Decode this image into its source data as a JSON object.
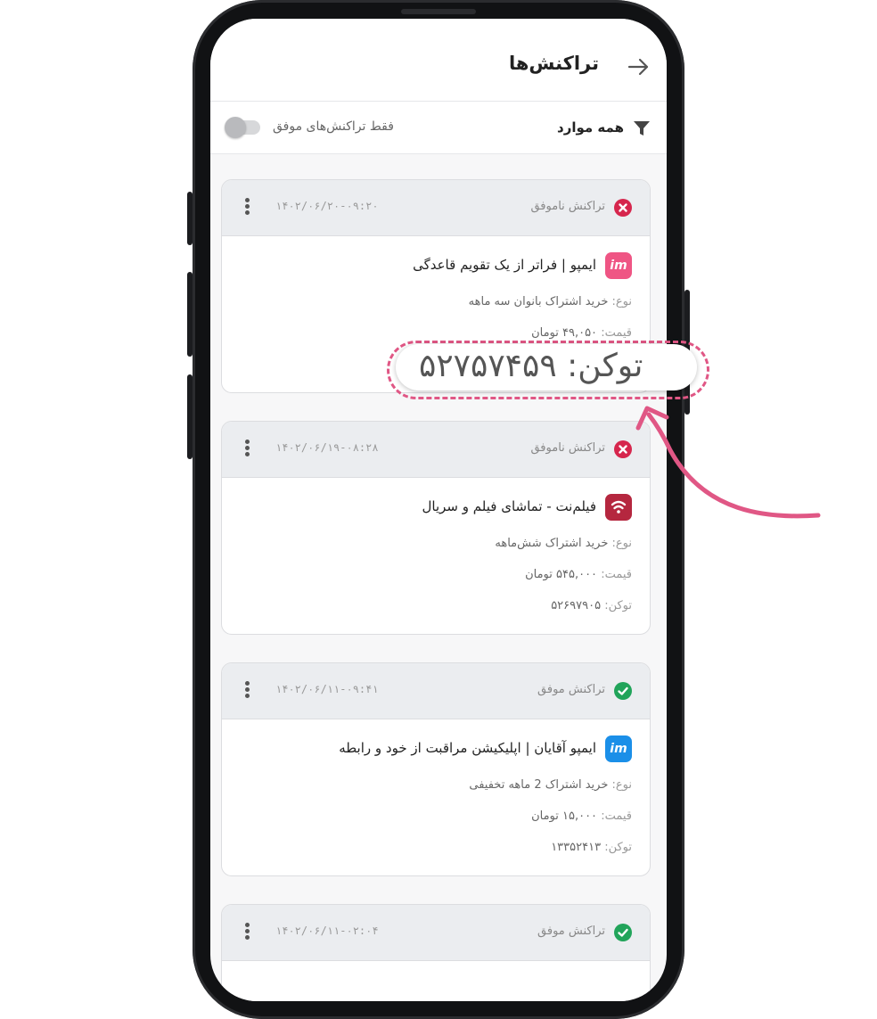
{
  "header": {
    "title": "تراکنش‌ها",
    "back_icon": "arrow-right-icon"
  },
  "filter": {
    "label": "همه موارد",
    "icon": "filter-icon",
    "toggle_label": "فقط تراکنش‌های موفق",
    "toggle_on": false
  },
  "labels": {
    "type_key": "نوع:",
    "price_key": "قیمت:",
    "token_key": "توکن:"
  },
  "transactions": [
    {
      "status": "تراکنش ناموفق",
      "status_type": "failed",
      "date": "۱۴۰۲/۰۶/۲۰-۰۹:۲۰",
      "app_logo_text": "im",
      "app_logo_color": "#ef5584",
      "app_name": "ایمپو | فراتر از یک تقویم قاعدگی",
      "type": "خرید اشتراک بانوان سه ماهه",
      "price": "۴۹,۰۵۰ تومان",
      "token": ""
    },
    {
      "status": "تراکنش ناموفق",
      "status_type": "failed",
      "date": "۱۴۰۲/۰۶/۱۹-۰۸:۲۸",
      "app_logo_text": "f",
      "app_logo_color": "#b5273f",
      "app_name": "فیلم‌نت - تماشای فیلم و سریال",
      "type": "خرید اشتراک شش‌ماهه",
      "price": "۵۴۵,۰۰۰ تومان",
      "token": "۵۲۶۹۷۹۰۵"
    },
    {
      "status": "تراکنش موفق",
      "status_type": "success",
      "date": "۱۴۰۲/۰۶/۱۱-۰۹:۴۱",
      "app_logo_text": "im",
      "app_logo_color": "#1b8fe8",
      "app_name": "ایمپو آقایان | اپلیکیشن مراقبت از خود و رابطه",
      "type": "خرید اشتراک 2 ماهه تخفیفی",
      "price": "۱۵,۰۰۰ تومان",
      "token": "۱۳۳۵۲۴۱۳"
    },
    {
      "status": "تراکنش موفق",
      "status_type": "success",
      "date": "۱۴۰۲/۰۶/۱۱-۰۲:۰۴"
    }
  ],
  "annotation": {
    "text": "توکن: ۵۲۷۵۷۴۵۹",
    "color": "#e05785"
  },
  "colors": {
    "failed": "#d6264d",
    "success": "#21a45a",
    "accent": "#e05785"
  }
}
